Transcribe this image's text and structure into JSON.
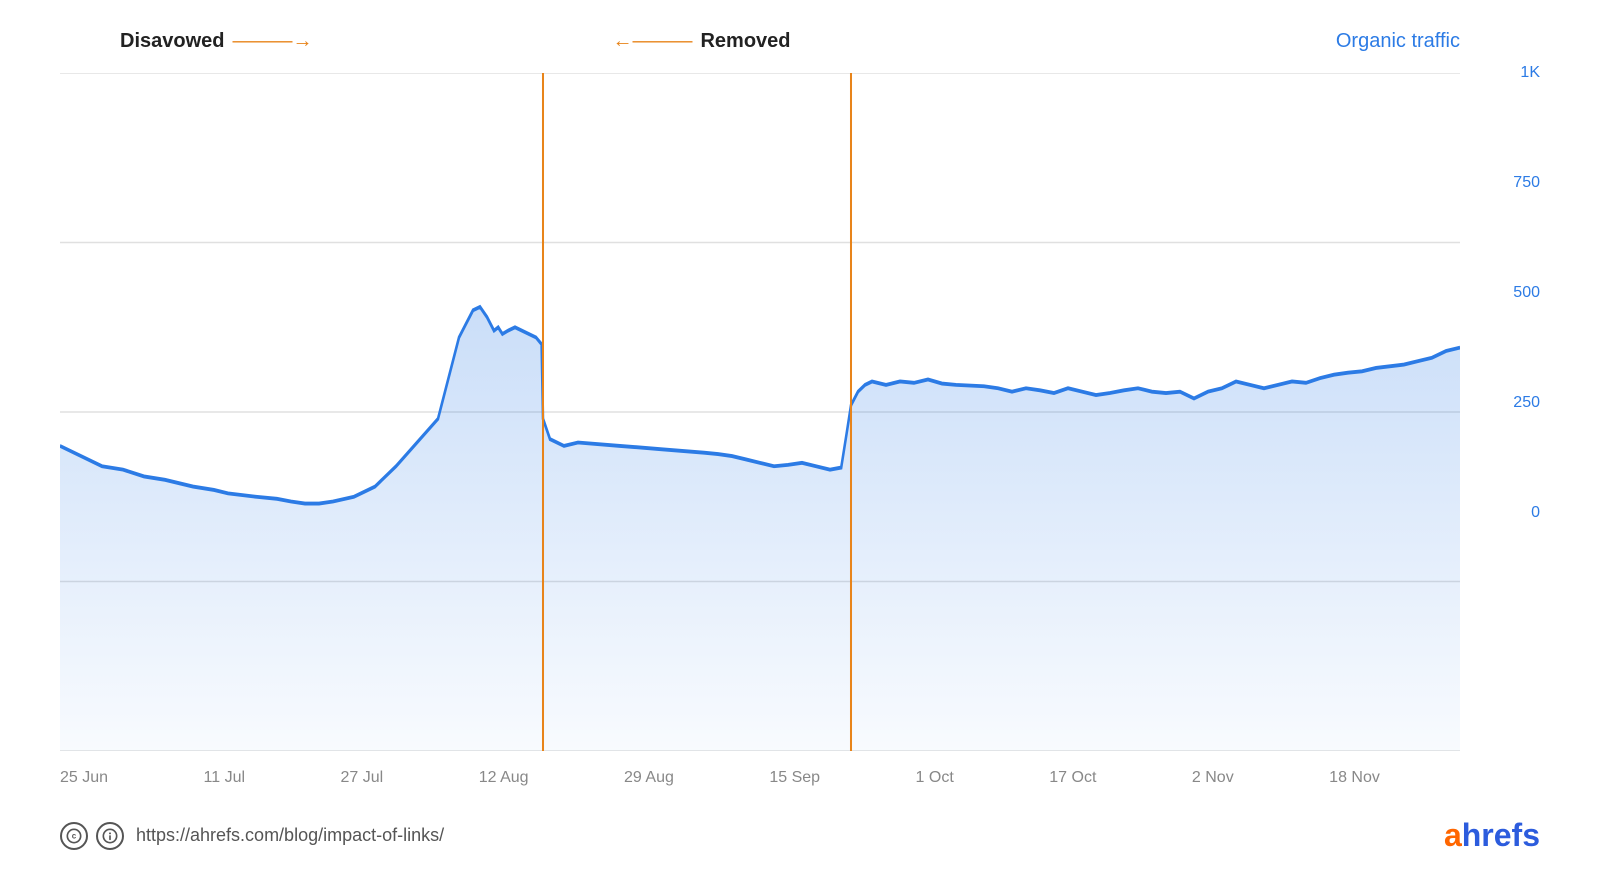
{
  "chart": {
    "title": "Organic traffic",
    "annotations": [
      {
        "label": "Disavowed",
        "direction": "right",
        "arrow": "→",
        "position_pct": 0.345
      },
      {
        "label": "Removed",
        "direction": "left",
        "arrow": "←",
        "position_pct": 0.565
      }
    ],
    "y_axis": {
      "ticks": [
        {
          "label": "1K",
          "value": 1000
        },
        {
          "label": "750",
          "value": 750
        },
        {
          "label": "500",
          "value": 500
        },
        {
          "label": "250",
          "value": 250
        },
        {
          "label": "0",
          "value": 0
        }
      ],
      "max": 1000,
      "min": 0
    },
    "x_axis": {
      "ticks": [
        "25 Jun",
        "11 Jul",
        "27 Jul",
        "12 Aug",
        "29 Aug",
        "15 Sep",
        "1 Oct",
        "17 Oct",
        "2 Nov",
        "18 Nov"
      ]
    },
    "vertical_lines": [
      {
        "position_pct": 0.345,
        "color": "#e8841a"
      },
      {
        "position_pct": 0.565,
        "color": "#e8841a"
      }
    ],
    "series_color": "#2c7be5",
    "fill_color_top": "rgba(44,123,229,0.15)",
    "fill_color_bottom": "rgba(44,123,229,0.02)"
  },
  "footer": {
    "url": "https://ahrefs.com/blog/impact-of-links/",
    "logo_text_a": "a",
    "logo_text_hrefs": "hrefs"
  }
}
